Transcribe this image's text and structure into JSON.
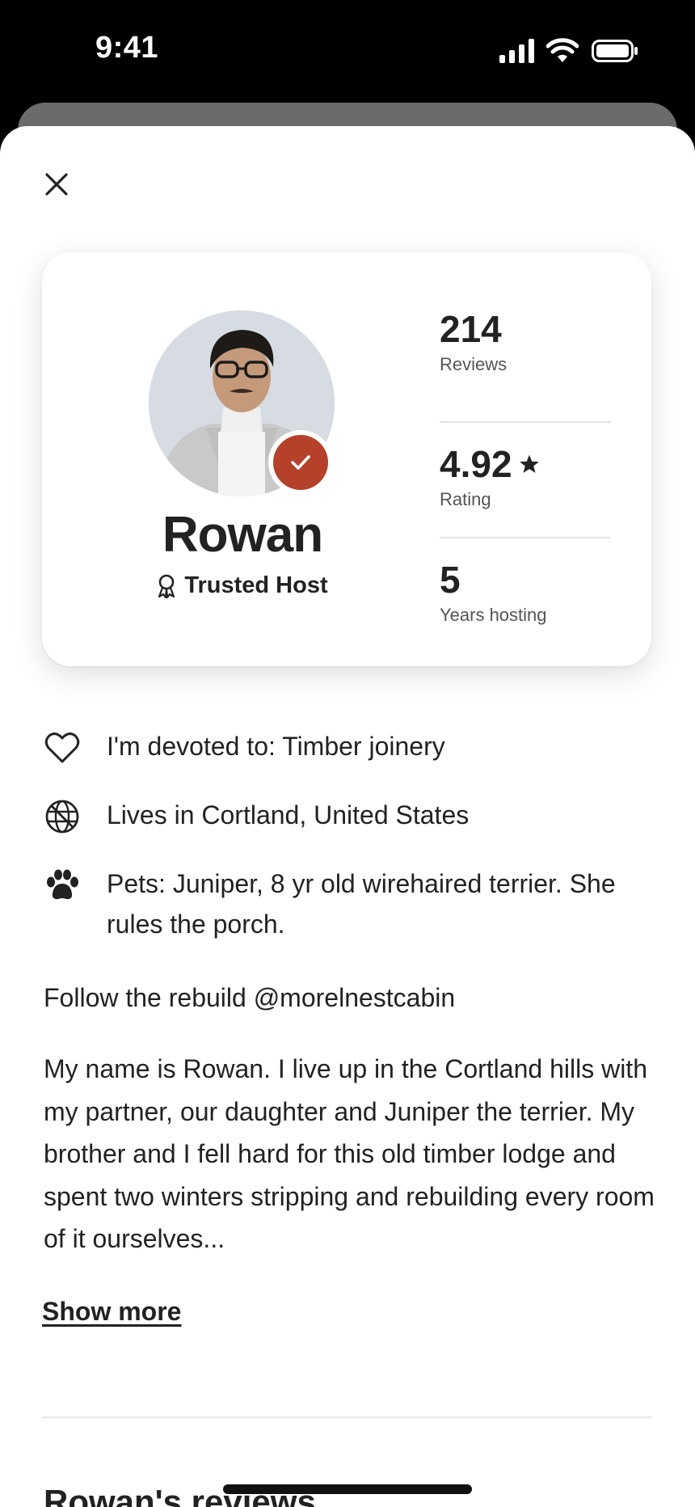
{
  "status_bar": {
    "time": "9:41",
    "signal_icon": "cellular-signal-icon",
    "wifi_icon": "wifi-icon",
    "battery_icon": "battery-icon"
  },
  "sheet": {
    "close_icon": "close-icon"
  },
  "profile": {
    "name": "Rowan",
    "badge_label": "Trusted Host",
    "badge_icon": "award-ribbon-icon",
    "verified_icon": "checkmark-icon",
    "accent_color": "#b5412b",
    "stats": [
      {
        "value": "214",
        "label": "Reviews"
      },
      {
        "value": "4.92",
        "label": "Rating",
        "icon": "star-icon"
      },
      {
        "value": "5",
        "label": "Years hosting"
      }
    ]
  },
  "facts": [
    {
      "icon": "heart-icon",
      "text": "I'm devoted to: Timber joinery"
    },
    {
      "icon": "globe-icon",
      "text": "Lives in Cortland, United States"
    },
    {
      "icon": "paw-icon",
      "text": "Pets: Juniper, 8 yr old wirehaired terrier. She rules the porch."
    }
  ],
  "follow_text": "Follow the rebuild @morelnestcabin",
  "bio": "My name is Rowan. I live up in the Cortland hills with my partner, our daughter and Juniper the terrier. My brother and I fell hard for this old timber lodge and spent two winters stripping and rebuilding every room of it ourselves...",
  "show_more_label": "Show more",
  "reviews_heading": "Rowan's reviews"
}
